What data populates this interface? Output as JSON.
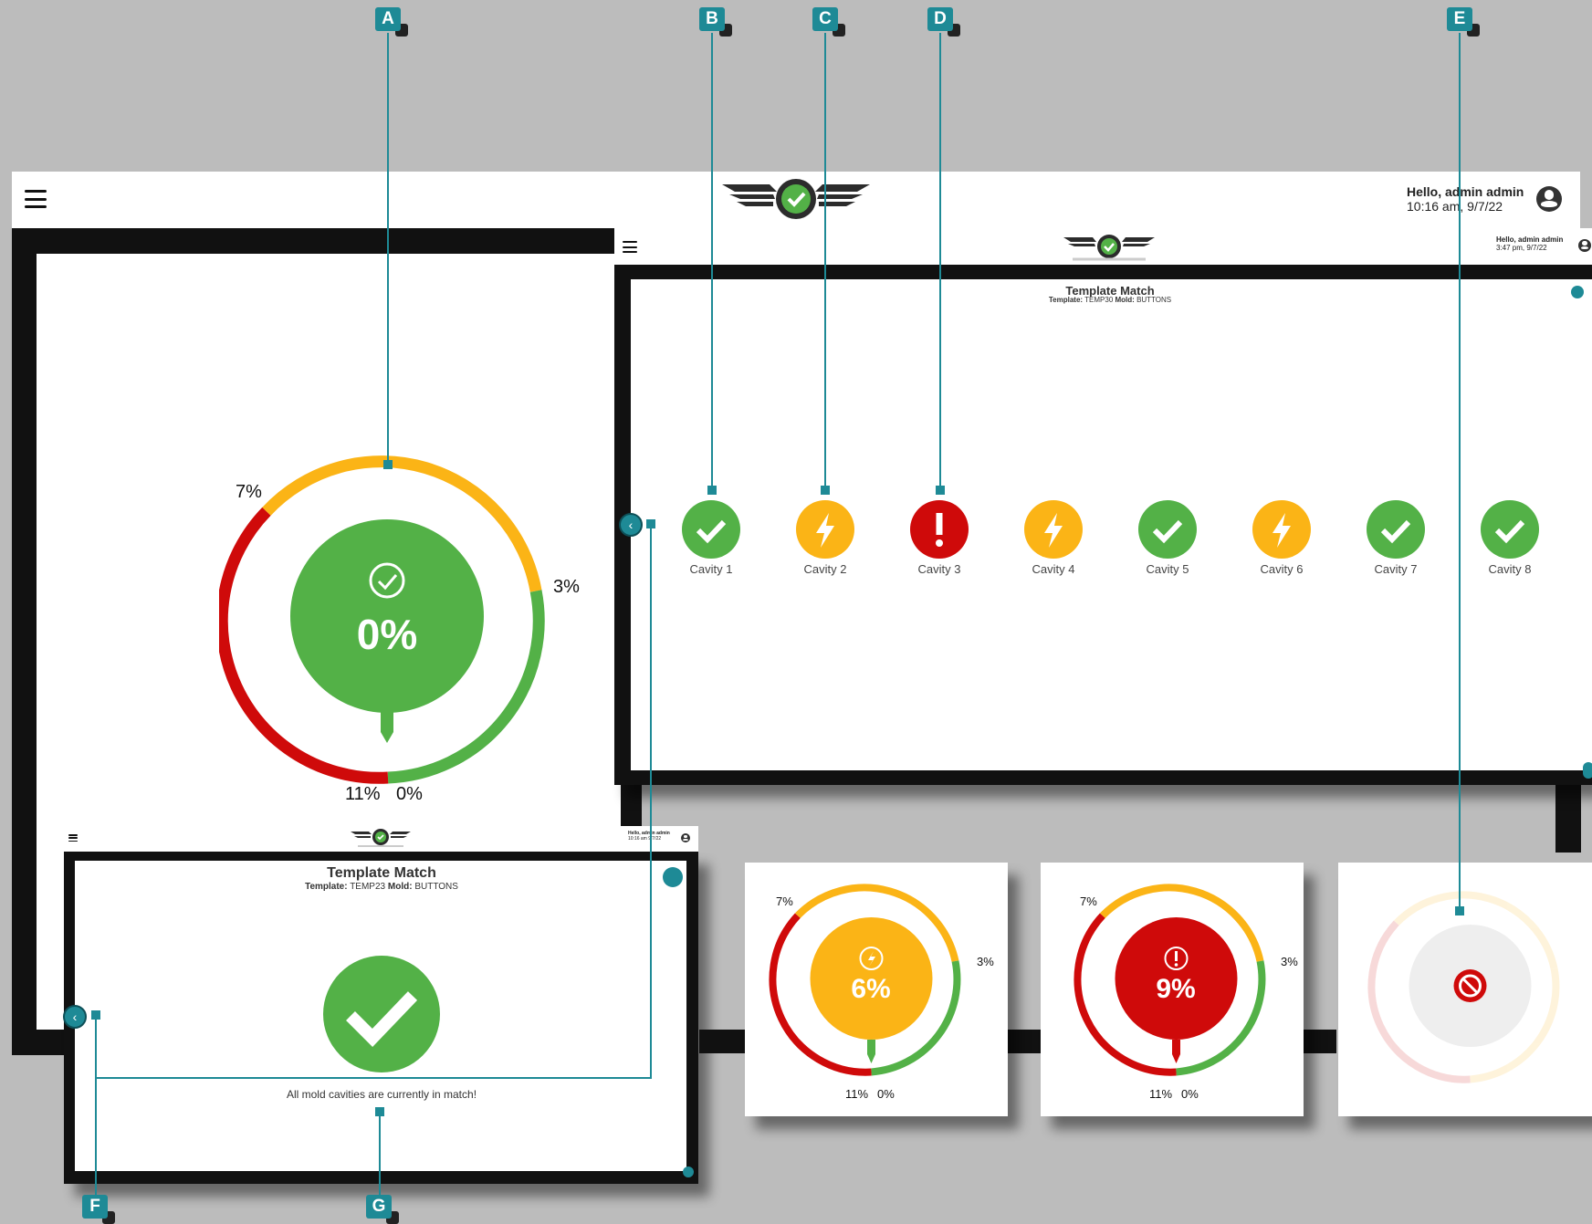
{
  "callouts": [
    "A",
    "B",
    "C",
    "D",
    "E",
    "F",
    "G"
  ],
  "main_header": {
    "greeting": "Hello, admin admin",
    "timestamp": "10:16 am, 9/7/22"
  },
  "big_gauge": {
    "center_value": "0%",
    "upper_left_label": "7%",
    "upper_right_label": "3%",
    "lower_left_label": "11%",
    "lower_right_label": "0%",
    "colors": {
      "good": "#53b147",
      "warn": "#fbb416",
      "bad": "#cf0a0a"
    }
  },
  "overlay_header": {
    "greeting": "Hello, admin admin",
    "timestamp": "3:47 pm, 9/7/22"
  },
  "overlay_widget": {
    "title": "Template Match",
    "template_label": "Template:",
    "template_value": "TEMP30",
    "mold_label": "Mold:",
    "mold_value": "BUTTONS",
    "cavities": [
      {
        "label": "Cavity 1",
        "status": "match",
        "icon": "check-icon"
      },
      {
        "label": "Cavity 2",
        "status": "warning",
        "icon": "lightning-icon"
      },
      {
        "label": "Cavity 3",
        "status": "alarm",
        "icon": "exclamation-icon"
      },
      {
        "label": "Cavity 4",
        "status": "warning",
        "icon": "lightning-icon"
      },
      {
        "label": "Cavity 5",
        "status": "match",
        "icon": "check-icon"
      },
      {
        "label": "Cavity 6",
        "status": "warning",
        "icon": "lightning-icon"
      },
      {
        "label": "Cavity 7",
        "status": "match",
        "icon": "check-icon"
      },
      {
        "label": "Cavity 8",
        "status": "match",
        "icon": "check-icon"
      }
    ]
  },
  "small_header": {
    "greeting": "Hello, admin admin",
    "timestamp": "10:16 am 9/7/22"
  },
  "small_widget": {
    "title": "Template Match",
    "template_label": "Template:",
    "template_value": "TEMP23",
    "mold_label": "Mold:",
    "mold_value": "BUTTONS",
    "message": "All mold cavities are currently in match!"
  },
  "mini_gauges": [
    {
      "center_value": "6%",
      "state": "warning",
      "icon": "lightning-icon",
      "upper_left": "7%",
      "upper_right": "3%",
      "lower_left": "11%",
      "lower_right": "0%"
    },
    {
      "center_value": "9%",
      "state": "alarm",
      "icon": "exclamation-icon",
      "upper_left": "7%",
      "upper_right": "3%",
      "lower_left": "11%",
      "lower_right": "0%"
    },
    {
      "center_value": "",
      "state": "disabled",
      "icon": "no-entry-icon"
    }
  ]
}
